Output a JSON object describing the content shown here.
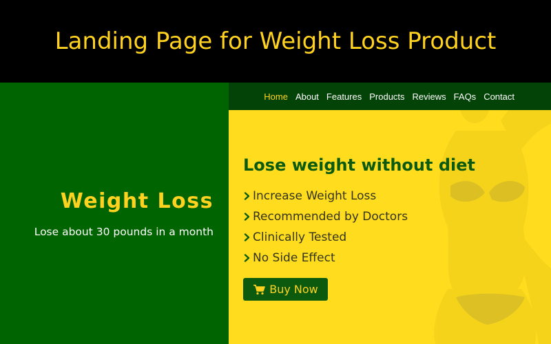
{
  "banner": {
    "title": "Landing Page for Weight Loss Product"
  },
  "colors": {
    "banner_bg": "#000000",
    "accent_yellow": "#FFD21F",
    "left_green": "#006400",
    "right_yellow": "#FFDD1E",
    "nav_green": "#044307",
    "button_green": "#0B5A0E"
  },
  "nav": {
    "items": [
      {
        "label": "Home",
        "active": true
      },
      {
        "label": "About"
      },
      {
        "label": "Features"
      },
      {
        "label": "Products"
      },
      {
        "label": "Reviews"
      },
      {
        "label": "FAQs"
      },
      {
        "label": "Contact"
      }
    ]
  },
  "hero": {
    "title": "Weight Loss",
    "subtitle": "Lose about 30 pounds in a month"
  },
  "main": {
    "headline": "Lose weight without diet",
    "features": [
      "Increase Weight Loss",
      "Recommended by Doctors",
      "Clinically Tested",
      "No Side Effect"
    ],
    "bullet_icon": "chevron-right-icon",
    "buy_button": {
      "label": "Buy Now",
      "icon": "shopping-cart-icon"
    }
  }
}
